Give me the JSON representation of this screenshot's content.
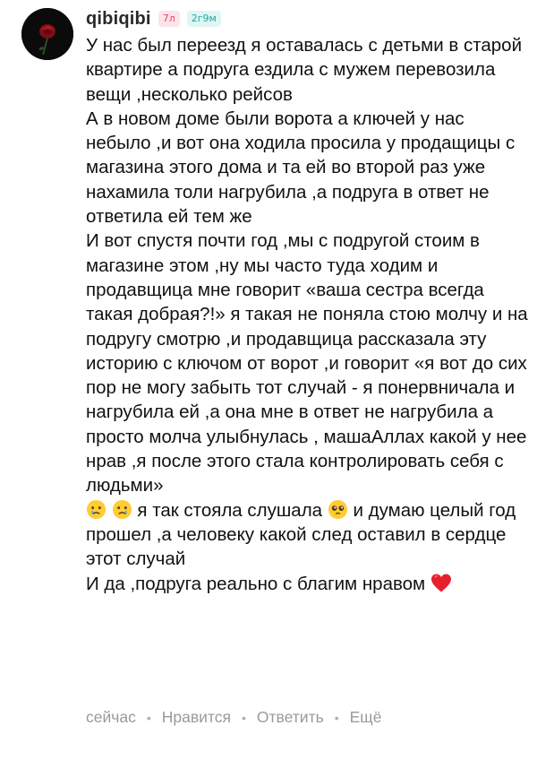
{
  "comment": {
    "username": "qibiqibi",
    "badge_age": "7л",
    "badge_time": "2г9м",
    "paragraphs": [
      "У нас был переезд я оставалась с детьми в старой квартире а подруга ездила с мужем перевозила вещи ,несколько рейсов",
      "А в новом доме были ворота а ключей у нас небыло ,и вот она ходила просила у продащицы с магазина этого дома и та ей во второй раз уже нахамила толи нагрубила ,а подруга в ответ не ответила ей тем же",
      "И вот спустя почти год ,мы с подругой стоим в магазине этом ,ну мы часто туда ходим и продавщица мне говорит «ваша сестра всегда такая добрая?!» я такая не поняла стою молчу и на подругу смотрю ,и продавщица рассказала эту историю с ключом от ворот ,и говорит «я вот до сих пор не могу забыть тот случай - я понервничала и нагрубила ей ,а она мне в ответ не нагрубила а просто молча улыбнулась , машаАллах какой у нее нрав ,я после этого стала контролировать себя с людьми»"
    ],
    "line_emoji_text": "я так стояла слушала",
    "line_emoji_text2": "и думаю целый год прошел ,а человеку какой след оставил в сердце этот случай",
    "last_line": "И да ,подруга реально с благим нравом",
    "icons": {
      "avatar": "rose-avatar",
      "crying": "crying-face-icon",
      "teary": "pleading-face-icon",
      "heart": "red-heart-icon"
    }
  },
  "actions": {
    "time": "сейчас",
    "like": "Нравится",
    "reply": "Ответить",
    "more": "Ещё",
    "separator": "•"
  },
  "colors": {
    "text": "#111111",
    "muted": "#9a9a9a",
    "badge_pink_bg": "#fde4ea",
    "badge_pink_fg": "#e8476b",
    "badge_teal_bg": "#dff6f4",
    "badge_teal_fg": "#21a99c",
    "heart": "#e8202e"
  }
}
